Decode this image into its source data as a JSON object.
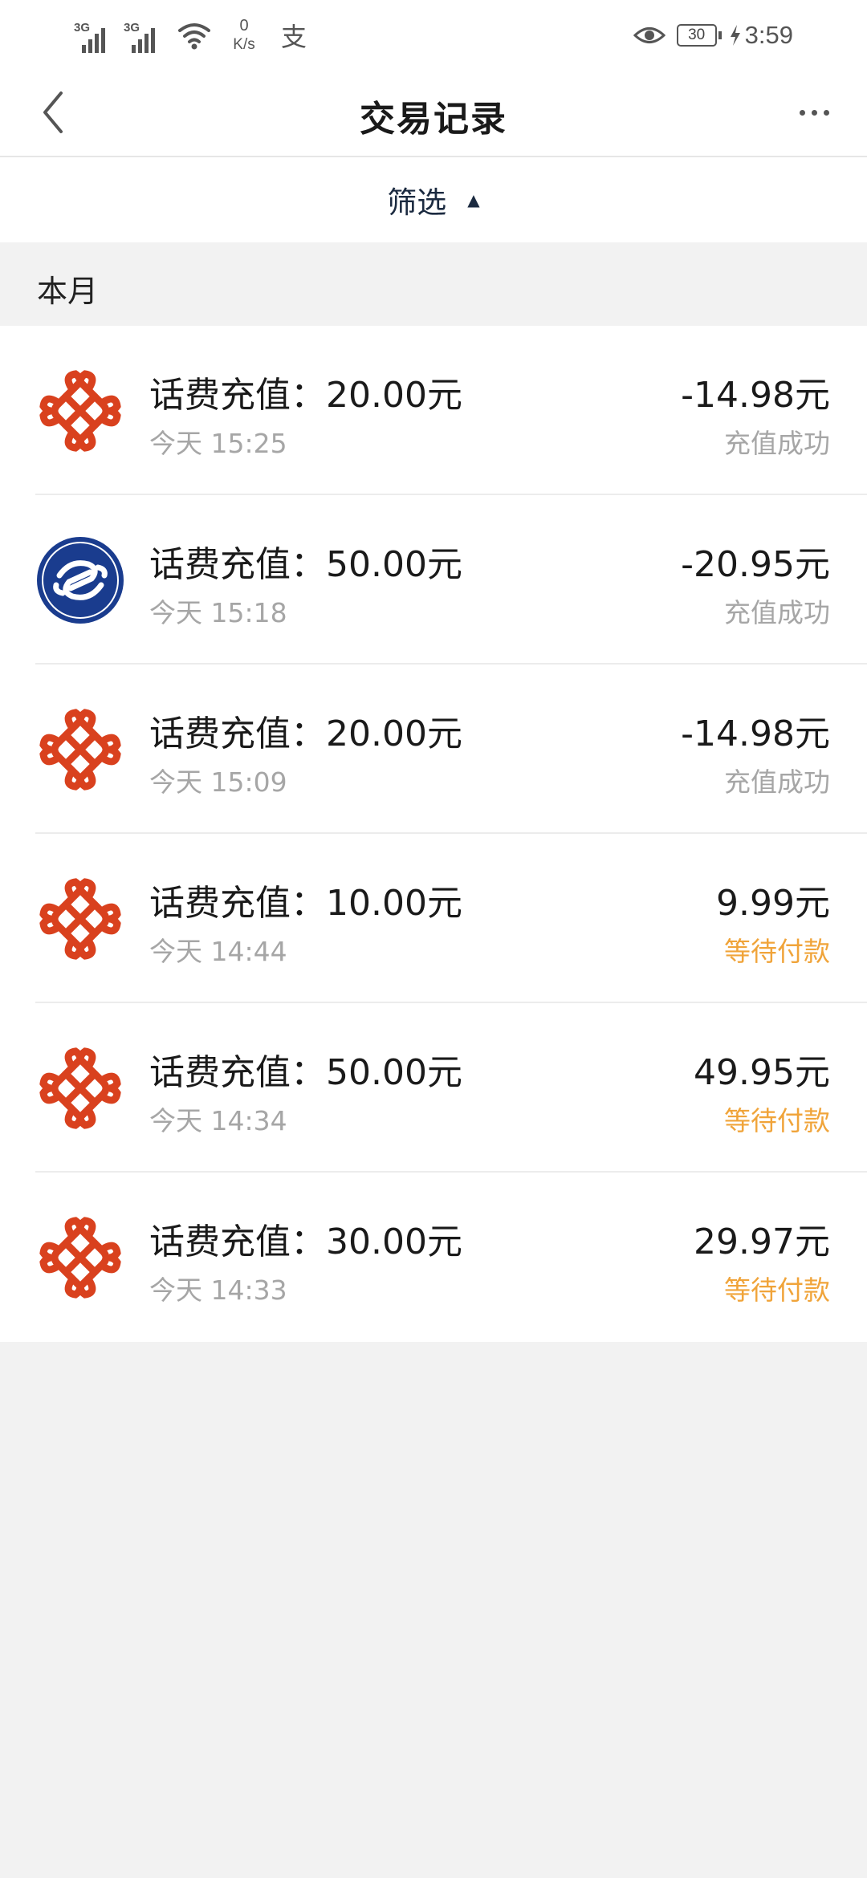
{
  "status_bar": {
    "signal1_label": "3G",
    "signal2_label": "3G",
    "net_speed_value": "0",
    "net_speed_unit": "K/s",
    "alipay_glyph": "支",
    "battery_level": "30",
    "time": "3:59",
    "icons": [
      "signal-icon",
      "signal-icon",
      "wifi-icon",
      "alipay-icon",
      "eye-icon",
      "battery-icon",
      "charging-bolt-icon"
    ]
  },
  "header": {
    "title": "交易记录",
    "back_icon": "chevron-left-icon",
    "more_icon": "more-dots-icon"
  },
  "filter": {
    "label": "筛选",
    "arrow": "▲"
  },
  "section": {
    "month_label": "本月"
  },
  "colors": {
    "unicom_red": "#d9411e",
    "mobile_blue": "#1a3c8e",
    "pending_orange": "#f0a43a",
    "secondary_gray": "#a6a6a6"
  },
  "transactions": [
    {
      "carrier_icon": "china-unicom-icon",
      "title": "话费充值：20.00元",
      "time": "今天 15:25",
      "amount": "-14.98元",
      "status": "充值成功",
      "status_type": "success"
    },
    {
      "carrier_icon": "china-mobile-icon",
      "title": "话费充值：50.00元",
      "time": "今天 15:18",
      "amount": "-20.95元",
      "status": "充值成功",
      "status_type": "success"
    },
    {
      "carrier_icon": "china-unicom-icon",
      "title": "话费充值：20.00元",
      "time": "今天 15:09",
      "amount": "-14.98元",
      "status": "充值成功",
      "status_type": "success"
    },
    {
      "carrier_icon": "china-unicom-icon",
      "title": "话费充值：10.00元",
      "time": "今天 14:44",
      "amount": "9.99元",
      "status": "等待付款",
      "status_type": "pending"
    },
    {
      "carrier_icon": "china-unicom-icon",
      "title": "话费充值：50.00元",
      "time": "今天 14:34",
      "amount": "49.95元",
      "status": "等待付款",
      "status_type": "pending"
    },
    {
      "carrier_icon": "china-unicom-icon",
      "title": "话费充值：30.00元",
      "time": "今天 14:33",
      "amount": "29.97元",
      "status": "等待付款",
      "status_type": "pending"
    }
  ]
}
